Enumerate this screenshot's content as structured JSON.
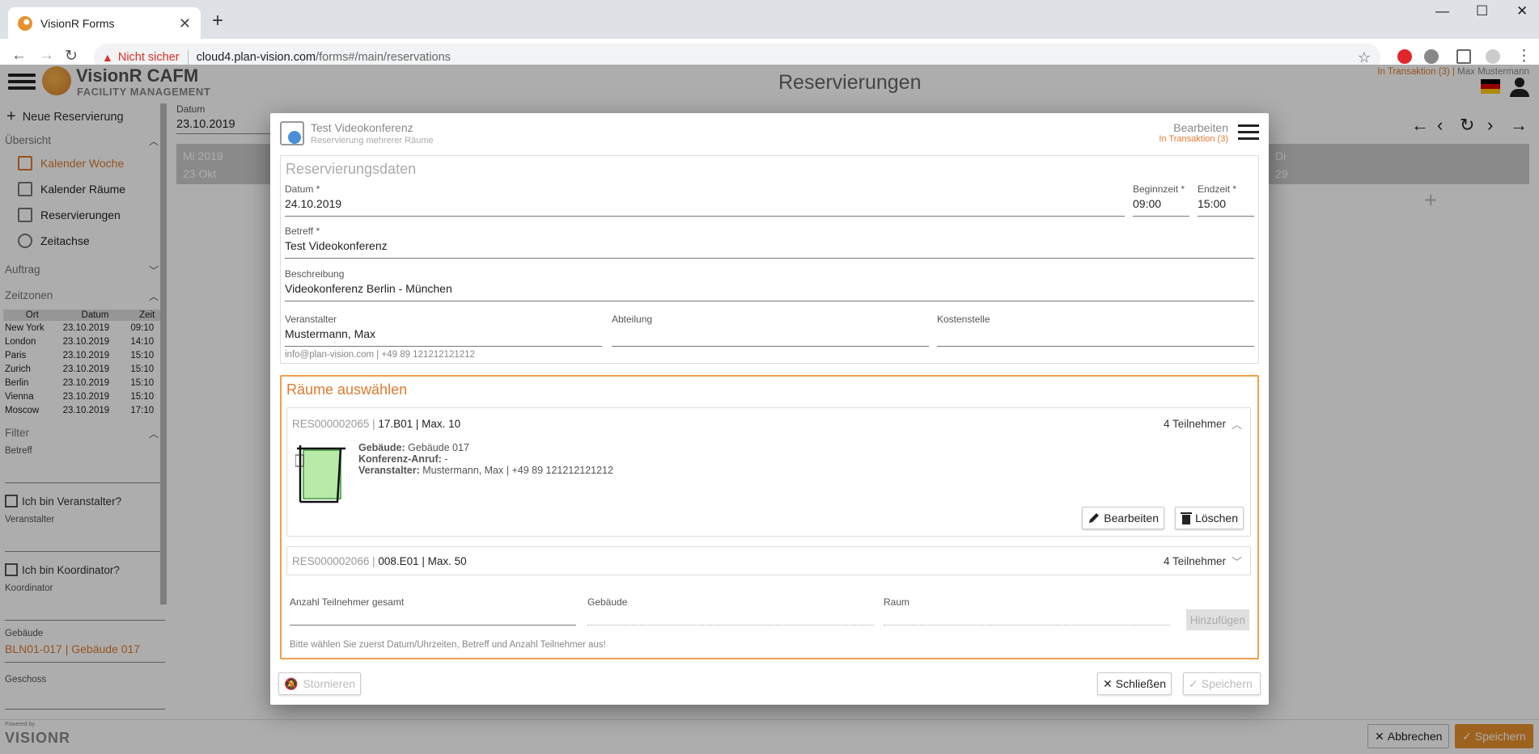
{
  "browser": {
    "tab_title": "VisionR Forms",
    "warning": "Nicht sicher",
    "url_host": "cloud4.plan-vision.com",
    "url_path": "/forms#/main/reservations"
  },
  "app": {
    "logo_title": "VisionR CAFM",
    "logo_sub": "FACILITY MANAGEMENT",
    "page_title": "Reservierungen",
    "transaction": "In Transaktion (3)",
    "user": "Max Mustermann",
    "flag_colors": [
      "#000000",
      "#dd0000",
      "#ffcc00"
    ]
  },
  "sidebar": {
    "new_label": "Neue Reservierung",
    "overview": "Übersicht",
    "items": [
      "Kalender Woche",
      "Kalender Räume",
      "Reservierungen",
      "Zeitachse"
    ],
    "auftrag": "Auftrag",
    "zeitzonen": "Zeitzonen",
    "tz_headers": [
      "Ort",
      "Datum",
      "Zeit"
    ],
    "tz_rows": [
      [
        "New York",
        "23.10.2019",
        "09:10"
      ],
      [
        "London",
        "23.10.2019",
        "14:10"
      ],
      [
        "Paris",
        "23.10.2019",
        "15:10"
      ],
      [
        "Zurich",
        "23.10.2019",
        "15:10"
      ],
      [
        "Berlin",
        "23.10.2019",
        "15:10"
      ],
      [
        "Vienna",
        "23.10.2019",
        "15:10"
      ],
      [
        "Moscow",
        "23.10.2019",
        "17:10"
      ]
    ],
    "filter": "Filter",
    "betreff": "Betreff",
    "veranstalter_cb": "Ich bin Veranstalter?",
    "veranstalter": "Veranstalter",
    "koord_cb": "Ich bin Koordinator?",
    "koordinator": "Koordinator",
    "gebaeude": "Gebäude",
    "gebaeude_val": "BLN01-017 | Gebäude 017",
    "geschoss": "Geschoss"
  },
  "calendar": {
    "date_label": "Datum",
    "date_value": "23.10.2019",
    "col1_day": "Mi 2019",
    "col1_date": "23  Okt",
    "col_last_day": "Di",
    "col_last_date": "29"
  },
  "footer": {
    "powered": "Powered by",
    "brand": "VISIONR",
    "abbrechen": "Abbrechen",
    "speichern": "Speichern"
  },
  "dialog": {
    "title": "Test Videokonferenz",
    "subtitle": "Reservierung mehrerer Räume",
    "action": "Bearbeiten",
    "transaction": "In Transaktion (3)",
    "section": "Reservierungsdaten",
    "datum_label": "Datum *",
    "datum": "24.10.2019",
    "begin_label": "Beginnzeit *",
    "begin": "09:00",
    "end_label": "Endzeit *",
    "end": "15:00",
    "betreff_label": "Betreff *",
    "betreff": "Test Videokonferenz",
    "beschr_label": "Beschreibung",
    "beschr": "Videokonferenz Berlin - München",
    "veranst_label": "Veranstalter",
    "veranst": "Mustermann, Max",
    "abteilung_label": "Abteilung",
    "abteilung": "",
    "kosten_label": "Kostenstelle",
    "kosten": "",
    "contact": "info@plan-vision.com | +49 89 121212121212",
    "rooms_title": "Räume auswählen",
    "room1": {
      "id": "RES000002065 |",
      "name": "17.B01 | Max. 10",
      "count": "4 Teilnehmer",
      "geb_k": "Gebäude:",
      "geb_v": "Gebäude 017",
      "konf_k": "Konferenz-Anruf:",
      "konf_v": "-",
      "ver_k": "Veranstalter:",
      "ver_v": "Mustermann, Max | +49 89 121212121212",
      "edit": "Bearbeiten",
      "del": "Löschen"
    },
    "room2": {
      "id": "RES000002066 |",
      "name": "008.E01 | Max. 50",
      "count": "4 Teilnehmer"
    },
    "anzahl_label": "Anzahl Teilnehmer gesamt",
    "geb_label": "Gebäude",
    "raum_label": "Raum",
    "add": "Hinzufügen",
    "hint": "Bitte wählen Sie zuerst Datum/Uhrzeiten, Betreff und Anzahl Teilnehmer aus!",
    "stornieren": "Stornieren",
    "schliessen": "Schließen",
    "speichern": "Speichern"
  }
}
